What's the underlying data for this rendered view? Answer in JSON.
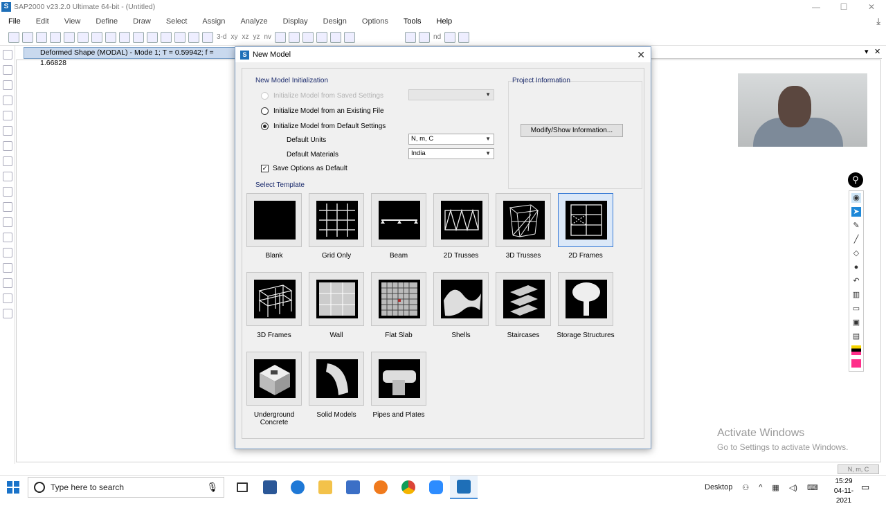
{
  "window": {
    "title": "SAP2000 v23.2.0 Ultimate 64-bit - (Untitled)",
    "min": "—",
    "max": "☐",
    "close": "✕"
  },
  "menu": [
    "File",
    "Edit",
    "View",
    "Define",
    "Draw",
    "Select",
    "Assign",
    "Analyze",
    "Display",
    "Design",
    "Options",
    "Tools",
    "Help"
  ],
  "toolbar": {
    "labels": [
      "3-d",
      "xy",
      "xz",
      "yz",
      "nv",
      "nd"
    ]
  },
  "document_tab": {
    "title": "Deformed Shape (MODAL) - Mode 1; T = 0.59942;  f = 1.66828"
  },
  "status": {
    "units": "N, m, C"
  },
  "dialog": {
    "title": "New Model",
    "close_label": "✕",
    "init_group": "New Model Initialization",
    "options": {
      "saved": "Initialize Model from Saved Settings",
      "existing": "Initialize Model from an Existing File",
      "default": "Initialize Model from Default Settings"
    },
    "default_units_label": "Default Units",
    "default_units_value": "N, m, C",
    "default_materials_label": "Default Materials",
    "default_materials_value": "India",
    "save_default_label": "Save Options as Default",
    "save_default_checked": true,
    "selected_option": "default",
    "project_group": "Project Information",
    "modify_button": "Modify/Show Information...",
    "template_group": "Select Template",
    "templates": [
      {
        "label": "Blank",
        "icon": "blank-template-icon"
      },
      {
        "label": "Grid Only",
        "icon": "grid-only-template-icon"
      },
      {
        "label": "Beam",
        "icon": "beam-template-icon"
      },
      {
        "label": "2D Trusses",
        "icon": "2d-trusses-template-icon"
      },
      {
        "label": "3D Trusses",
        "icon": "3d-trusses-template-icon"
      },
      {
        "label": "2D Frames",
        "icon": "2d-frames-template-icon",
        "selected": true
      },
      {
        "label": "3D Frames",
        "icon": "3d-frames-template-icon"
      },
      {
        "label": "Wall",
        "icon": "wall-template-icon"
      },
      {
        "label": "Flat Slab",
        "icon": "flat-slab-template-icon"
      },
      {
        "label": "Shells",
        "icon": "shells-template-icon"
      },
      {
        "label": "Staircases",
        "icon": "staircases-template-icon"
      },
      {
        "label": "Storage Structures",
        "icon": "storage-structures-template-icon"
      },
      {
        "label": "Underground Concrete",
        "icon": "underground-concrete-template-icon"
      },
      {
        "label": "Solid Models",
        "icon": "solid-models-template-icon"
      },
      {
        "label": "Pipes and Plates",
        "icon": "pipes-and-plates-template-icon"
      }
    ]
  },
  "watermark": {
    "line1": "Activate Windows",
    "line2": "Go to Settings to activate Windows."
  },
  "taskbar": {
    "search_placeholder": "Type here to search",
    "desktop_label": "Desktop",
    "time": "15:29",
    "date": "04-11-2021",
    "apps": [
      "task-view",
      "word",
      "edge",
      "file-explorer",
      "store",
      "firefox",
      "chrome",
      "zoom",
      "sap2000"
    ]
  },
  "colors": {
    "accent": "#3a7bd5",
    "tab_bg": "#c9d9ee",
    "dialog_border": "#7a9cc5",
    "group_title": "#1a2a6c"
  }
}
